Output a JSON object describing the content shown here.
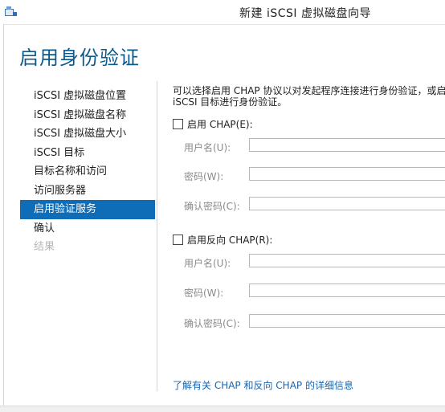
{
  "window": {
    "title": "新建 iSCSI 虚拟磁盘向导",
    "icon": "wizard-app-icon"
  },
  "page": {
    "heading": "启用身份验证"
  },
  "nav": {
    "items": [
      {
        "label": "iSCSI 虚拟磁盘位置",
        "state": "normal"
      },
      {
        "label": "iSCSI 虚拟磁盘名称",
        "state": "normal"
      },
      {
        "label": "iSCSI 虚拟磁盘大小",
        "state": "normal"
      },
      {
        "label": "iSCSI 目标",
        "state": "normal"
      },
      {
        "label": "目标名称和访问",
        "state": "normal"
      },
      {
        "label": "访问服务器",
        "state": "normal"
      },
      {
        "label": "启用验证服务",
        "state": "active"
      },
      {
        "label": "确认",
        "state": "normal"
      },
      {
        "label": "结果",
        "state": "disabled"
      }
    ]
  },
  "content": {
    "description_line1": "可以选择启用 CHAP 协议以对发起程序连接进行身份验证，或启用",
    "description_line2": "iSCSI 目标进行身份验证。",
    "chap": {
      "label": "启用 CHAP(E):",
      "checked": false,
      "username_label": "用户名(U):",
      "username_value": "",
      "password_label": "密码(W):",
      "password_value": "",
      "confirm_label": "确认密码(C):",
      "confirm_value": ""
    },
    "reverse_chap": {
      "label": "启用反向 CHAP(R):",
      "checked": false,
      "username_label": "用户名(U):",
      "username_value": "",
      "password_label": "密码(W):",
      "password_value": "",
      "confirm_label": "确认密码(C):",
      "confirm_value": ""
    },
    "help_link": "了解有关 CHAP 和反向 CHAP 的详细信息"
  },
  "colors": {
    "accent": "#0f6cb6",
    "heading": "#0b5a8c",
    "link": "#1666b0",
    "disabled_text": "#b6b6b6"
  }
}
